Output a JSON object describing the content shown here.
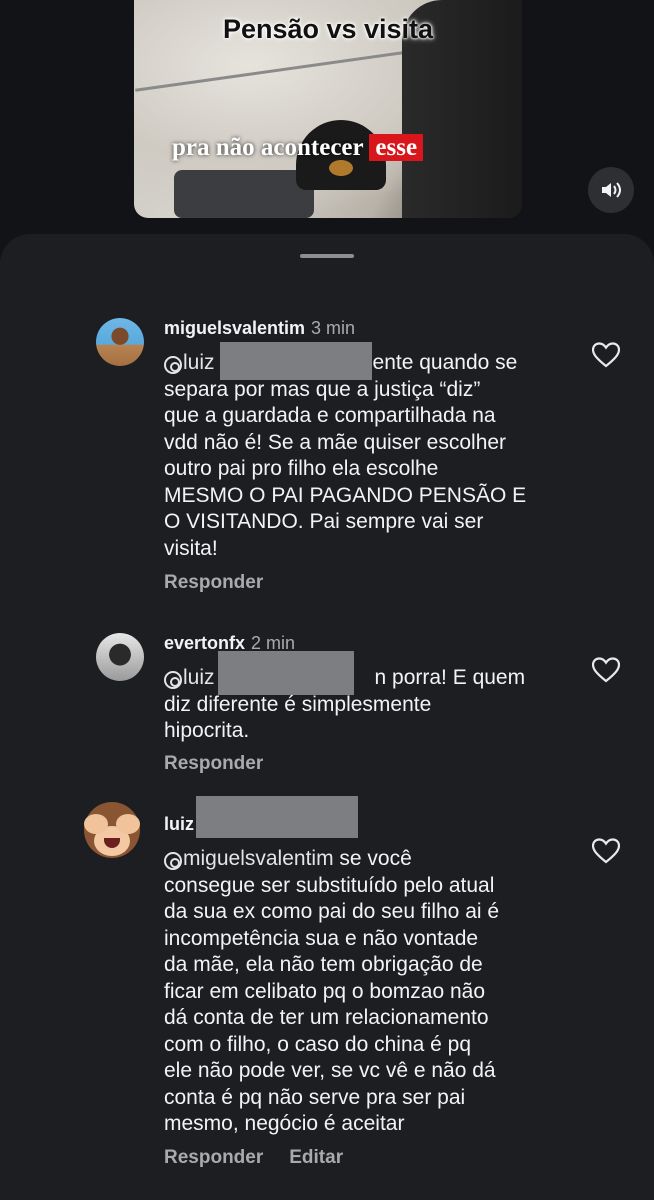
{
  "video": {
    "title": "Pensão vs visita",
    "subtitle_prefix": "pra não acontecer",
    "subtitle_highlight": "esse",
    "volume_icon": "speaker-icon"
  },
  "sheet": {
    "handle": "drag-handle"
  },
  "comments": [
    {
      "username": "miguelsvalentim",
      "time": "3 min",
      "mention": "luiz",
      "lines": [
        "ente quando se",
        "separa por mas que a justiça “diz”",
        "que a guardada e compartilhada na",
        "vdd não é! Se a mãe quiser escolher",
        "outro pai pro filho ela escolhe",
        "MESMO O PAI PAGANDO PENSÃO E",
        "O VISITANDO. Pai sempre vai ser",
        "visita!"
      ],
      "reply_label": "Responder"
    },
    {
      "username": "evertonfx",
      "time": "2 min",
      "mention": "luiz",
      "lines": [
        "n porra! E quem",
        "diz diferente é simplesmente",
        "hipocrita."
      ],
      "reply_label": "Responder"
    },
    {
      "username": "luiz",
      "time": "",
      "mention": "miguelsvalentim",
      "lines": [
        " se você",
        "consegue ser substituído pelo atual",
        "da sua ex como pai do seu filho ai é",
        "incompetência sua e não vontade",
        "da mãe, ela não tem obrigação de",
        "ficar em celibato pq o bomzao não",
        "dá conta de ter um relacionamento",
        "com o filho, o caso do china é pq",
        "ele não pode ver, se vc vê e não dá",
        "conta é pq não serve pra ser pai",
        "mesmo, negócio é aceitar"
      ],
      "reply_label": "Responder",
      "edit_label": "Editar"
    }
  ]
}
